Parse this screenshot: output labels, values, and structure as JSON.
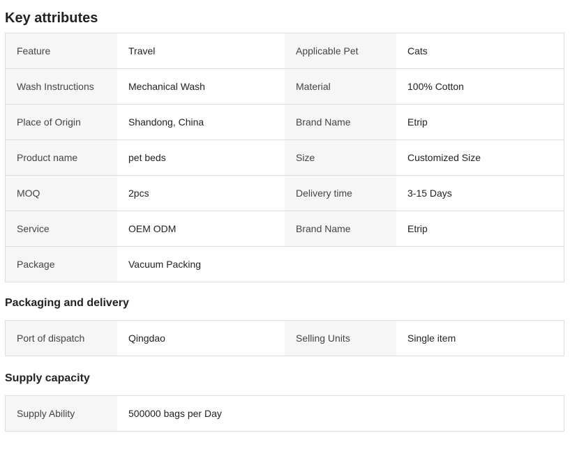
{
  "key_attributes": {
    "title": "Key attributes",
    "rows": [
      {
        "left_label": "Feature",
        "left_value": "Travel",
        "right_label": "Applicable Pet",
        "right_value": "Cats"
      },
      {
        "left_label": "Wash Instructions",
        "left_value": "Mechanical Wash",
        "right_label": "Material",
        "right_value": "100% Cotton"
      },
      {
        "left_label": "Place of Origin",
        "left_value": "Shandong, China",
        "right_label": "Brand Name",
        "right_value": "Etrip"
      },
      {
        "left_label": "Product name",
        "left_value": "pet beds",
        "right_label": "Size",
        "right_value": "Customized Size"
      },
      {
        "left_label": "MOQ",
        "left_value": "2pcs",
        "right_label": "Delivery time",
        "right_value": "3-15 Days"
      },
      {
        "left_label": "Service",
        "left_value": "OEM ODM",
        "right_label": "Brand Name",
        "right_value": "Etrip"
      },
      {
        "left_label": "Package",
        "left_value": "Vacuum Packing"
      }
    ]
  },
  "packaging": {
    "title": "Packaging and delivery",
    "rows": [
      {
        "left_label": "Port of dispatch",
        "left_value": "Qingdao",
        "right_label": "Selling Units",
        "right_value": "Single item"
      }
    ]
  },
  "supply": {
    "title": "Supply capacity",
    "rows": [
      {
        "left_label": "Supply Ability",
        "left_value": "500000 bags per Day"
      }
    ]
  }
}
